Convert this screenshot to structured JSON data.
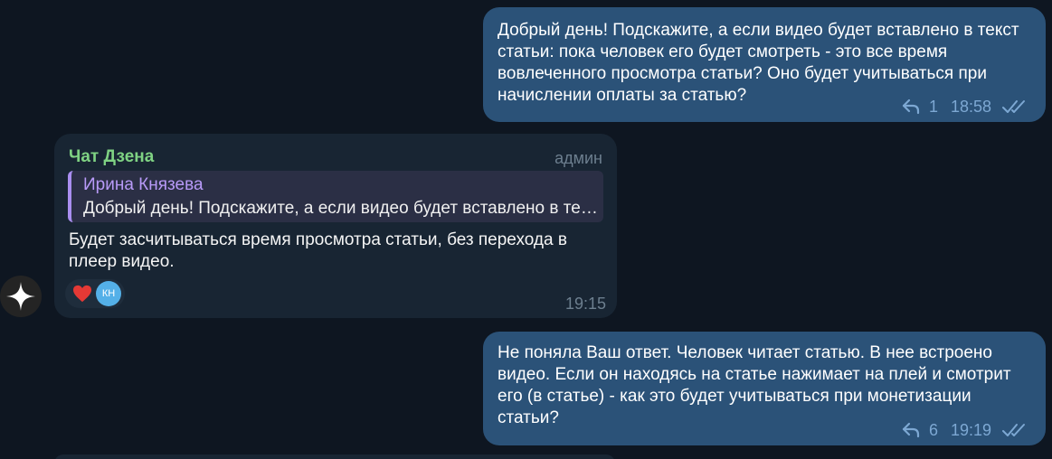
{
  "messages": {
    "out1": {
      "text": "Добрый день! Подскажите, а если видео будет вставлено в текст статьи: пока человек его будет смотреть - это все время вовлеченного просмотра статьи? Оно будет учитываться при начислении оплаты за статью?",
      "replies": "1",
      "time": "18:58"
    },
    "in1": {
      "sender": "Чат Дзена",
      "role": "админ",
      "quote_author": "Ирина Князева",
      "quote_text": "Добрый день! Подскажите, а если видео будет вставлено в текст статьи",
      "text": "Будет засчитываться время просмотра статьи, без перехода в плеер видео.",
      "reaction_avatar": "КН",
      "time": "19:15"
    },
    "out2": {
      "text": "Не поняла Ваш ответ. Человек читает статью. В нее встроено видео. Если он находясь на статье нажимает на плей и смотрит его (в статье) - как это будет учитываться при монетизации статьи?",
      "replies": "6",
      "time": "19:19"
    }
  },
  "colors": {
    "background": "#0e1621",
    "outgoing_bubble": "#2b5278",
    "incoming_bubble": "#182533",
    "sender_name": "#7fd283",
    "quote_accent": "#a98ef0",
    "heart": "#e53935",
    "avatar": "#54b0e8"
  },
  "icons": [
    "reply-icon",
    "double-check-icon",
    "heart-icon",
    "sparkle-icon"
  ]
}
